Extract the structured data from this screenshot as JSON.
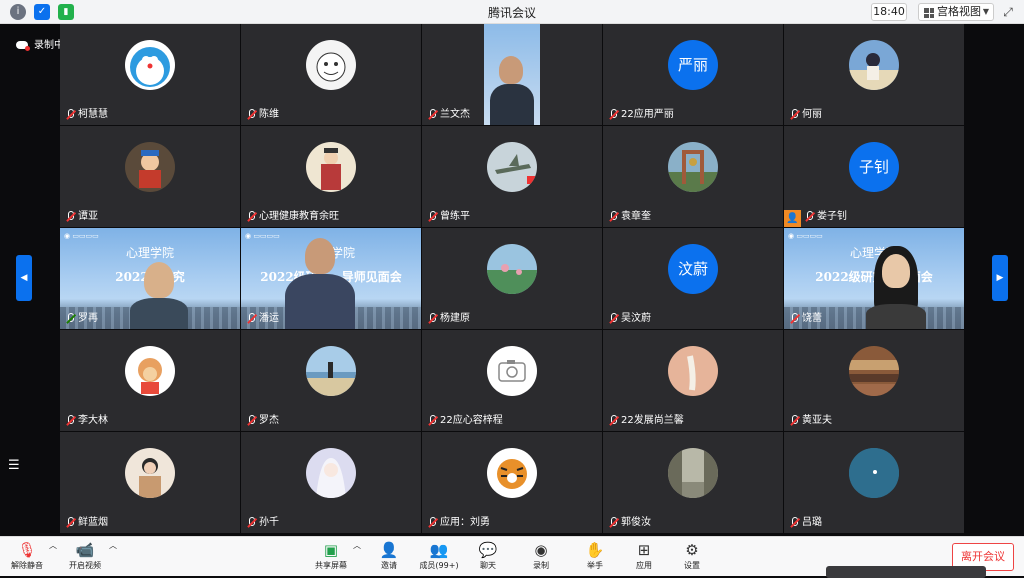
{
  "window": {
    "title": "腾讯会议",
    "clock": "18:40",
    "view_label": "宫格视图"
  },
  "recording": {
    "label": "录制中"
  },
  "participants": [
    {
      "name": "柯慧慧",
      "avatar": "doraemon-avatar",
      "avatar_color": "#3aa0e0"
    },
    {
      "name": "陈维",
      "avatar": "meme-face-avatar",
      "avatar_color": "#f2f2f2"
    },
    {
      "name": "兰文杰",
      "avatar": "video-man-avatar",
      "avatar_color": "#c7d9ef"
    },
    {
      "name": "22应用严丽",
      "avatar_text": "严丽"
    },
    {
      "name": "何丽",
      "avatar": "cartoon-girl-avatar",
      "avatar_color": "#7aa7d6"
    },
    {
      "name": "谭亚",
      "avatar": "clown-doll-avatar",
      "avatar_color": "#c43b2c"
    },
    {
      "name": "心理健康教育余旺",
      "avatar": "opera-figure-avatar",
      "avatar_color": "#d8c8a8"
    },
    {
      "name": "曾练平",
      "avatar": "fighter-jet-avatar",
      "avatar_color": "#b9c4c8"
    },
    {
      "name": "袁章奎",
      "avatar": "bell-tower-avatar",
      "avatar_color": "#6a8a5a"
    },
    {
      "name": "娄子钊",
      "avatar_text": "子钊"
    },
    {
      "name": "罗再",
      "avatar": "video-banner-man"
    },
    {
      "name": "潘运",
      "avatar": "video-banner-man2"
    },
    {
      "name": "杨建原",
      "avatar": "lotus-avatar",
      "avatar_color": "#5f9f6a"
    },
    {
      "name": "吴汶蔚",
      "avatar_text": "汶蔚"
    },
    {
      "name": "饶蕾",
      "avatar": "video-banner-woman"
    },
    {
      "name": "李大林",
      "avatar": "monkey-avatar",
      "avatar_color": "#f0c890"
    },
    {
      "name": "罗杰",
      "avatar": "beach-avatar",
      "avatar_color": "#8ab4d8"
    },
    {
      "name": "22应心容梓程",
      "avatar": "camera-avatar",
      "avatar_color": "#ffffff"
    },
    {
      "name": "22发展尚兰馨",
      "avatar": "painting-avatar",
      "avatar_color": "#e6b49a"
    },
    {
      "name": "黄亚夫",
      "avatar": "theater-avatar",
      "avatar_color": "#a06a4a"
    },
    {
      "name": "鲜蓝烟",
      "avatar": "girl-photo-avatar",
      "avatar_color": "#d8b89a"
    },
    {
      "name": "孙千",
      "avatar": "anime-girl-avatar",
      "avatar_color": "#c8c8e8"
    },
    {
      "name": "应用：刘勇",
      "avatar": "tiger-avatar",
      "avatar_color": "#e0a050"
    },
    {
      "name": "郭俊汝",
      "avatar": "street-avatar",
      "avatar_color": "#a8a89a"
    },
    {
      "name": "吕璐",
      "avatar": "ocean-avatar",
      "avatar_color": "#3a7a9a"
    }
  ],
  "banner": {
    "school": "心理学院",
    "school_en": "School of Psychology",
    "event": "2022级研究生导师见面会",
    "event_partial_1": "2022级研究",
    "event_partial_2": "2022级研",
    "event_partial_2b": "导师见面会",
    "event_partial_3": "2022级研究",
    "event_partial_3b": "面会"
  },
  "toolbar": {
    "unmute": "解除静音",
    "start_video": "开启视频",
    "share": "共享屏幕",
    "invite": "邀请",
    "members": "成员(99+)",
    "chat": "聊天",
    "record": "录制",
    "raise_hand": "举手",
    "apps": "应用",
    "settings": "设置",
    "leave": "离开会议"
  }
}
